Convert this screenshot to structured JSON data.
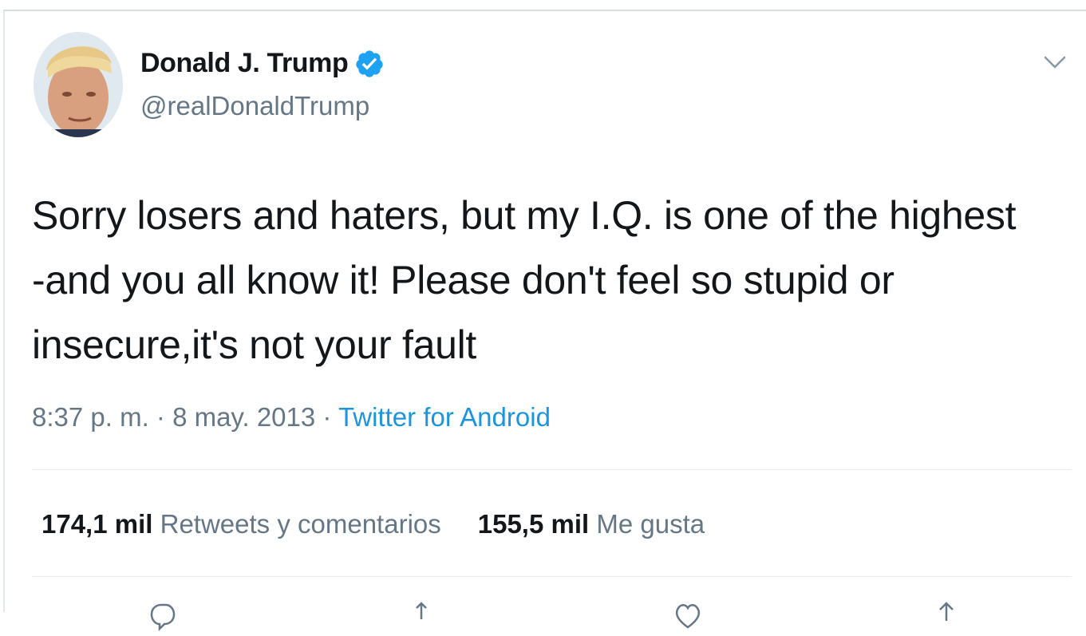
{
  "tweet": {
    "author": {
      "display_name": "Donald J. Trump",
      "handle": "@realDonaldTrump",
      "verified": true
    },
    "text_lines": [
      "Sorry losers and haters, but my I.Q. is one of the highest",
      "-and you all know it! Please don't feel so stupid or",
      "insecure,it's not your fault"
    ],
    "time": "8:37 p. m. · 8 may. 2013 · ",
    "source": "Twitter for Android",
    "stats": {
      "retweets_count": "174,1 mil",
      "retweets_label": "Retweets y comentarios",
      "likes_count": "155,5 mil",
      "likes_label": "Me gusta"
    }
  },
  "icons": {
    "verified": "verified-badge-icon",
    "menu": "chevron-down-icon",
    "reply": "reply-icon",
    "retweet": "retweet-icon",
    "like": "heart-icon",
    "share": "share-icon"
  },
  "colors": {
    "text": "#14171a",
    "secondary": "#657786",
    "link": "#1b95e0",
    "verified": "#1da1f2",
    "divider": "#e6ecf0"
  }
}
